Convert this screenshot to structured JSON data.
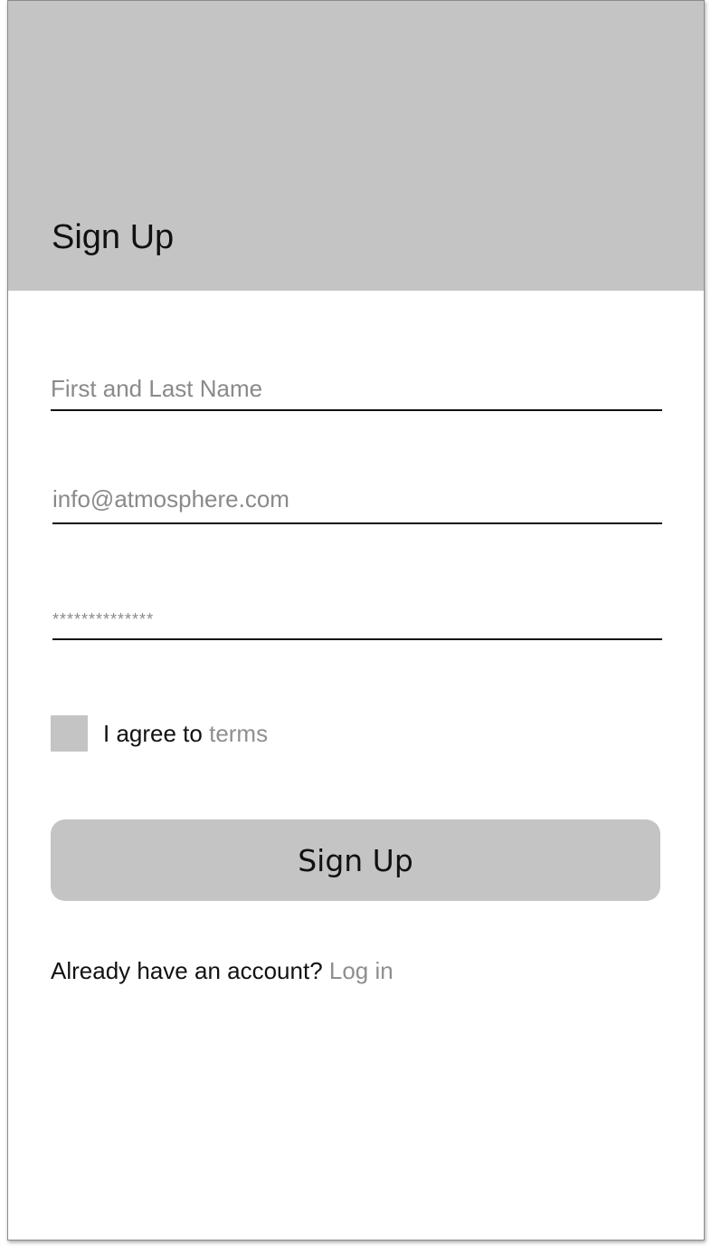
{
  "header": {
    "title": "Sign Up"
  },
  "form": {
    "name_placeholder": "First and Last Name",
    "email_placeholder": "info@atmosphere.com",
    "password_placeholder": "**************",
    "agree_label": "I agree to",
    "terms_link": "terms",
    "submit_label": "Sign Up"
  },
  "footer": {
    "prompt": "Already have an account?",
    "login_link": "Log in"
  },
  "colors": {
    "header_bg": "#c4c4c4",
    "button_bg": "#c4c4c4",
    "link": "#8f8f8f",
    "text": "#111111"
  }
}
